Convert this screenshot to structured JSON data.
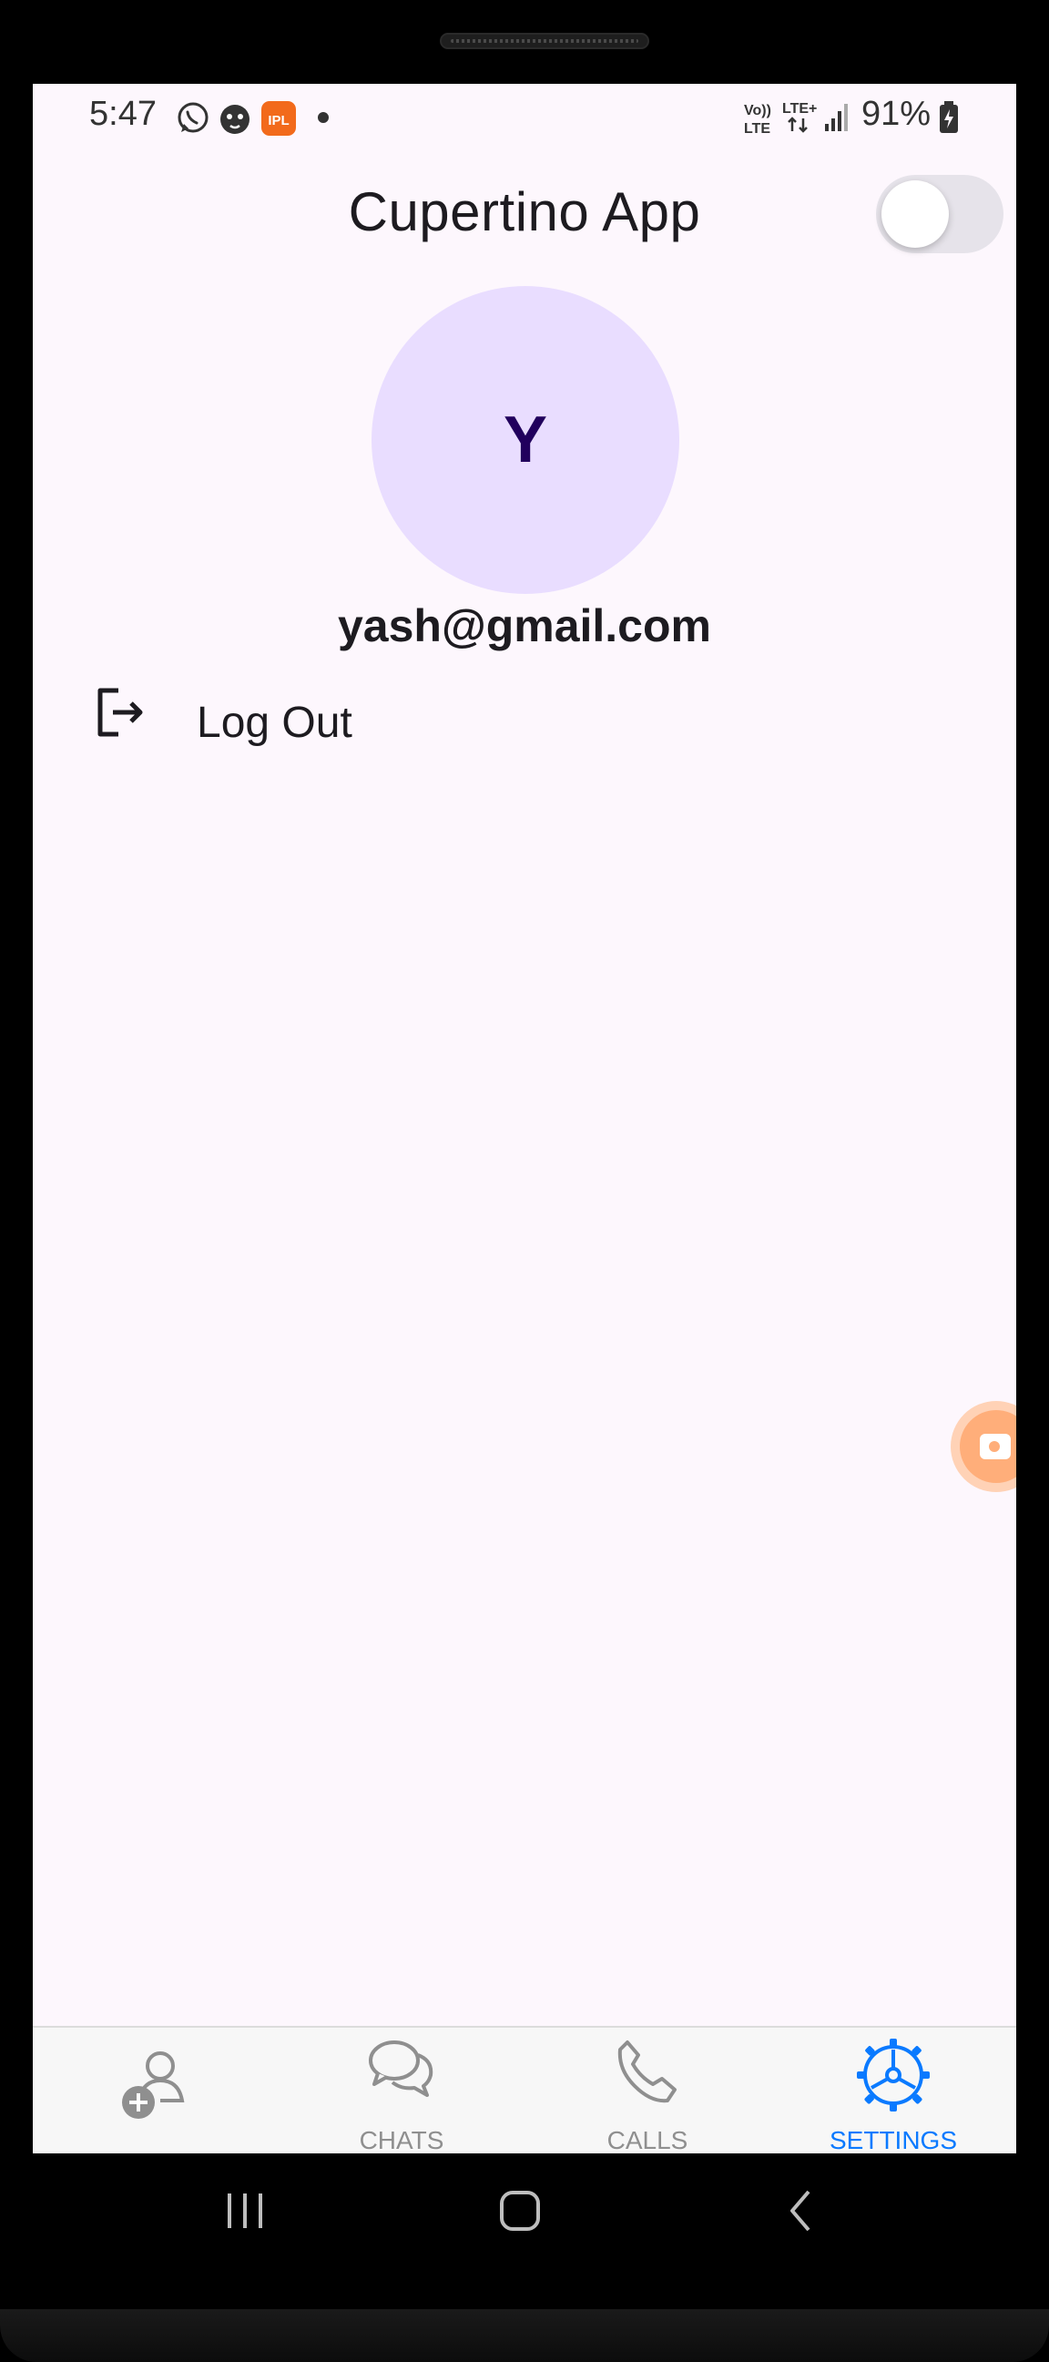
{
  "status_bar": {
    "time": "5:47",
    "notification_icons": [
      "whatsapp-icon",
      "android-notification-icon",
      "ipl-app-icon",
      "dot-icon"
    ],
    "network": {
      "volte_label": "Vo))\nLTE",
      "lte_label": "LTE+"
    },
    "battery": "91%"
  },
  "app": {
    "title": "Cupertino App",
    "theme_toggle": {
      "on": false
    }
  },
  "profile": {
    "avatar_letter": "Y",
    "email": "yash@gmail.com"
  },
  "menu": {
    "logout_label": "Log Out"
  },
  "tabs": [
    {
      "label": "",
      "icon": "add-contact-icon",
      "active": false
    },
    {
      "label": "CHATS",
      "icon": "chats-icon",
      "active": false
    },
    {
      "label": "CALLS",
      "icon": "phone-icon",
      "active": false
    },
    {
      "label": "SETTINGS",
      "icon": "settings-gear-icon",
      "active": true
    }
  ],
  "colors": {
    "background": "#fdf7fd",
    "avatar_bg": "#e9ddff",
    "avatar_text": "#21005d",
    "active_tab": "#0a7aff",
    "inactive_tab": "#8f8f8f"
  }
}
